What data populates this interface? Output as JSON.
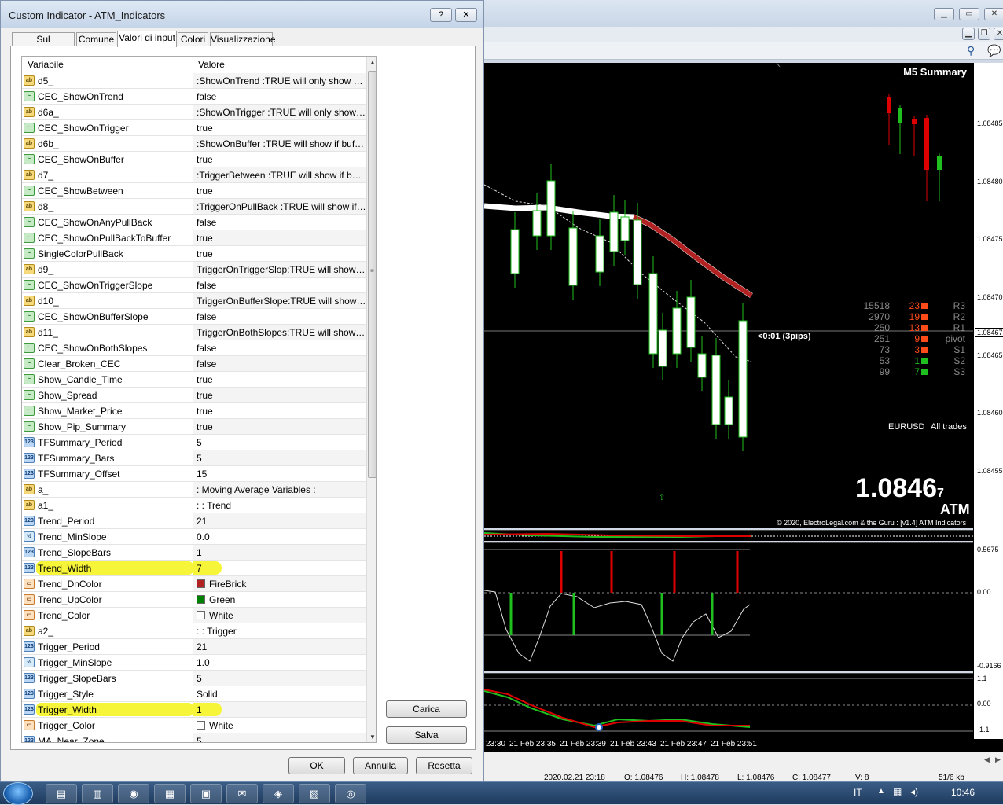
{
  "dialog": {
    "title": "Custom Indicator - ATM_Indicators",
    "help_label": "?",
    "close_label": "✕",
    "tabs": [
      {
        "label": "Sul programma"
      },
      {
        "label": "Comune"
      },
      {
        "label": "Valori di input"
      },
      {
        "label": "Colori"
      },
      {
        "label": "Visualizzazione"
      }
    ],
    "active_tab": "Valori di input",
    "grid": {
      "col_variable": "Variabile",
      "col_value": "Valore",
      "rows": [
        {
          "type": "string",
          "name": "d5_",
          "value": ":ShowOnTrend :TRUE will only show with ..."
        },
        {
          "type": "bool",
          "name": "CEC_ShowOnTrend",
          "value": "false"
        },
        {
          "type": "string",
          "name": "d6a_",
          "value": ":ShowOnTrigger :TRUE will only show if n..."
        },
        {
          "type": "bool",
          "name": "CEC_ShowOnTrigger",
          "value": "true"
        },
        {
          "type": "string",
          "name": "d6b_",
          "value": ":ShowOnBuffer :TRUE will show if buffer li..."
        },
        {
          "type": "bool",
          "name": "CEC_ShowOnBuffer",
          "value": "true"
        },
        {
          "type": "string",
          "name": "d7_",
          "value": ":TriggerBetween :TRUE will show if betwe..."
        },
        {
          "type": "bool",
          "name": "CEC_ShowBetween",
          "value": "true"
        },
        {
          "type": "string",
          "name": "d8_",
          "value": ":TriggerOnPullBack :TRUE will show if pull..."
        },
        {
          "type": "bool",
          "name": "CEC_ShowOnAnyPullBack",
          "value": "false"
        },
        {
          "type": "bool",
          "name": "CEC_ShowOnPullBackToBuffer",
          "value": "true"
        },
        {
          "type": "bool",
          "name": "SingleColorPullBack",
          "value": "true"
        },
        {
          "type": "string",
          "name": "d9_",
          "value": "TriggerOnTriggerSlop:TRUE will show if tri..."
        },
        {
          "type": "bool",
          "name": "CEC_ShowOnTriggerSlope",
          "value": "false"
        },
        {
          "type": "string",
          "name": "d10_",
          "value": "TriggerOnBufferSlope:TRUE will show if b..."
        },
        {
          "type": "bool",
          "name": "CEC_ShowOnBufferSlope",
          "value": "false"
        },
        {
          "type": "string",
          "name": "d11_",
          "value": "TriggerOnBothSlopes:TRUE will show if tri..."
        },
        {
          "type": "bool",
          "name": "CEC_ShowOnBothSlopes",
          "value": "false"
        },
        {
          "type": "bool",
          "name": "Clear_Broken_CEC",
          "value": "false"
        },
        {
          "type": "bool",
          "name": "Show_Candle_Time",
          "value": "true"
        },
        {
          "type": "bool",
          "name": "Show_Spread",
          "value": "true"
        },
        {
          "type": "bool",
          "name": "Show_Market_Price",
          "value": "true"
        },
        {
          "type": "bool",
          "name": "Show_Pip_Summary",
          "value": "true"
        },
        {
          "type": "int",
          "name": "TFSummary_Period",
          "value": "5"
        },
        {
          "type": "int",
          "name": "TFSummary_Bars",
          "value": "5"
        },
        {
          "type": "int",
          "name": "TFSummary_Offset",
          "value": "15"
        },
        {
          "type": "string",
          "name": "a_",
          "value": " : Moving Average Variables :"
        },
        {
          "type": "string",
          "name": "a1_",
          "value": " : : Trend"
        },
        {
          "type": "int",
          "name": "Trend_Period",
          "value": "21"
        },
        {
          "type": "double",
          "name": "Trend_MinSlope",
          "value": "0.0"
        },
        {
          "type": "int",
          "name": "Trend_SlopeBars",
          "value": "1"
        },
        {
          "type": "int",
          "name": "Trend_Width",
          "value": "7",
          "highlight": true
        },
        {
          "type": "color",
          "name": "Trend_DnColor",
          "value": "FireBrick",
          "swatch": "#b22222"
        },
        {
          "type": "color",
          "name": "Trend_UpColor",
          "value": "Green",
          "swatch": "#008000"
        },
        {
          "type": "color",
          "name": "Trend_Color",
          "value": "White",
          "swatch": "#ffffff"
        },
        {
          "type": "string",
          "name": "a2_",
          "value": " : : Trigger"
        },
        {
          "type": "int",
          "name": "Trigger_Period",
          "value": "21"
        },
        {
          "type": "double",
          "name": "Trigger_MinSlope",
          "value": "1.0"
        },
        {
          "type": "int",
          "name": "Trigger_SlopeBars",
          "value": "5"
        },
        {
          "type": "int",
          "name": "Trigger_Style",
          "value": "Solid"
        },
        {
          "type": "int",
          "name": "Trigger_Width",
          "value": "1",
          "highlight": true
        },
        {
          "type": "color",
          "name": "Trigger_Color",
          "value": "White",
          "swatch": "#ffffff"
        },
        {
          "type": "int",
          "name": "MA_Near_Zone",
          "value": "5"
        }
      ]
    },
    "buttons": {
      "load": "Carica",
      "save": "Salva",
      "ok": "OK",
      "cancel": "Annulla",
      "reset": "Resetta"
    }
  },
  "terminal": {
    "summary_title": "M5 Summary",
    "countdown": "<0:01 (3pips)",
    "symbol": "EURUSD",
    "trades_label": "All trades",
    "price_big": "1.0846",
    "price_small": "7",
    "brand": "ATM",
    "copyright": "© 2020, ElectroLegal.com & the Guru : [v1.4] ATM Indicators",
    "pivots": [
      {
        "num": "15518",
        "pips": "23",
        "name": "R3",
        "color": "#ff4a1a"
      },
      {
        "num": "2970",
        "pips": "19",
        "name": "R2",
        "color": "#ff4a1a"
      },
      {
        "num": "250",
        "pips": "13",
        "name": "R1",
        "color": "#ff4a1a"
      },
      {
        "num": "251",
        "pips": "9",
        "name": "pivot",
        "color": "#ff4a1a"
      },
      {
        "num": "73",
        "pips": "3",
        "name": "S1",
        "color": "#ff4a1a"
      },
      {
        "num": "53",
        "pips": "1",
        "name": "S2",
        "color": "#1fbf1f"
      },
      {
        "num": "99",
        "pips": "7",
        "name": "S3",
        "color": "#1fbf1f"
      }
    ],
    "price_labels": [
      "1.08485",
      "1.08480",
      "1.08475",
      "1.08470",
      "1.08467",
      "1.08465",
      "1.08460",
      "1.08455"
    ],
    "osc_labels": [
      "0.5675",
      "0.00",
      "-0.9166"
    ],
    "osc2_labels": [
      "1.1",
      "0.00",
      "-1.1"
    ],
    "time_labels": [
      "23:30",
      "21 Feb 23:35",
      "21 Feb 23:39",
      "21 Feb 23:43",
      "21 Feb 23:47",
      "21 Feb 23:51"
    ],
    "status": {
      "datetime": "2020.02.21 23:18",
      "open": "O: 1.08476",
      "high": "H: 1.08478",
      "low": "L: 1.08476",
      "close": "C: 1.08477",
      "volume": "V: 8",
      "traffic": "51/6 kb"
    }
  },
  "taskbar": {
    "lang": "IT",
    "clock": "10:46"
  }
}
